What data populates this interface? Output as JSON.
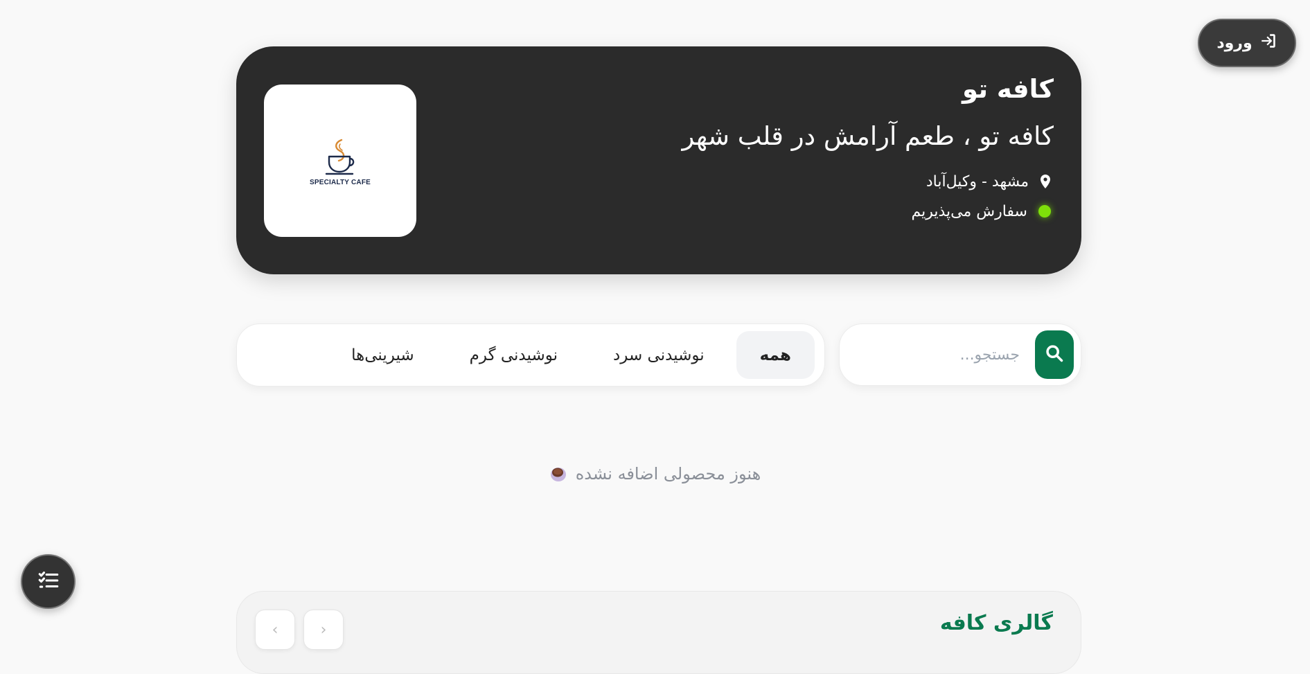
{
  "header": {
    "login_label": "ورود"
  },
  "hero": {
    "title": "کافه تو",
    "tagline": "کافه تو ، طعم آرامش در قلب شهر",
    "location": "مشهد - وکیل‌آباد",
    "status": "سفارش می‌پذیریم",
    "logo_text": "SPECIALTY CAFE",
    "status_color": "#7ee00a"
  },
  "search": {
    "placeholder": "جستجو...",
    "button_color": "#0a7a4f"
  },
  "categories": {
    "items": [
      {
        "label": "همه",
        "active": true
      },
      {
        "label": "نوشیدنی سرد",
        "active": false
      },
      {
        "label": "نوشیدنی گرم",
        "active": false
      },
      {
        "label": "شیرینی‌ها",
        "active": false
      }
    ]
  },
  "products": {
    "empty_message": "هنوز محصولی اضافه نشده"
  },
  "gallery": {
    "title": "گالری کافه"
  },
  "icons": {
    "login": "sign-in-icon",
    "location": "map-pin-icon",
    "search": "search-icon",
    "empty": "coffee-cup-icon",
    "menu": "checklist-icon"
  }
}
